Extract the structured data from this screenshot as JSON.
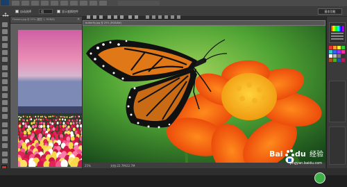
{
  "doc1": {
    "tab_label": "Flowers.jpg @ 25% (图层 1, RGB/8)",
    "zoom": "25%",
    "doc_size": "文档:22.7M/44.7M"
  },
  "doc2": {
    "tab_label": "butterfly.jpg @ 25% (RGB/8#)",
    "zoom": "25%",
    "doc_size": "文档:22.7M/22.7M"
  },
  "options": {
    "auto_select": "自动选择",
    "auto_select_value": "组",
    "show_transform": "显示变换控件"
  },
  "workspace": {
    "label": "基本功能"
  },
  "watermark": {
    "brand": "Bai",
    "brand2": "du",
    "brand_cn": "经验",
    "url": "jingyan.baidu.com"
  },
  "colors": {
    "accent": "#1a3f6b",
    "swatch_red": "#d62d2d",
    "swatch_green": "#3fae49"
  }
}
